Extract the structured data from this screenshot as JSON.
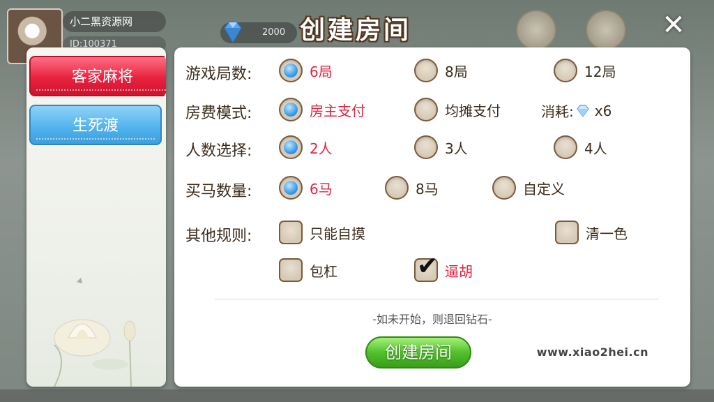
{
  "lobby": {
    "user_name": "小二黑资源网",
    "user_id": "ID:100371",
    "gem_count": "2000"
  },
  "dialog": {
    "title": "创建房间",
    "close_label": "✕"
  },
  "tabs": [
    {
      "label": "客家麻将",
      "active": true
    },
    {
      "label": "生死渡",
      "active": false
    }
  ],
  "rows": {
    "rounds": {
      "label": "游戏局数:",
      "options": [
        {
          "label": "6局",
          "selected": true
        },
        {
          "label": "8局",
          "selected": false
        },
        {
          "label": "12局",
          "selected": false
        }
      ]
    },
    "fee_mode": {
      "label": "房费模式:",
      "options": [
        {
          "label": "房主支付",
          "selected": true
        },
        {
          "label": "均摊支付",
          "selected": false
        }
      ],
      "cost_label": "消耗:",
      "cost_value": "x6"
    },
    "players": {
      "label": "人数选择:",
      "options": [
        {
          "label": "2人",
          "selected": true
        },
        {
          "label": "3人",
          "selected": false
        },
        {
          "label": "4人",
          "selected": false
        }
      ]
    },
    "horses": {
      "label": "买马数量:",
      "options": [
        {
          "label": "6马",
          "selected": true
        },
        {
          "label": "8马",
          "selected": false
        },
        {
          "label": "自定义",
          "selected": false
        }
      ]
    },
    "other_rules": {
      "label": "其他规则:",
      "options": [
        {
          "label": "只能自摸",
          "checked": false
        },
        {
          "label": "清一色",
          "checked": false
        },
        {
          "label": "包杠",
          "checked": false
        },
        {
          "label": "逼胡",
          "checked": true
        }
      ]
    }
  },
  "footer": {
    "refund_note": "-如未开始，则退回钻石-",
    "create_label": "创建房间",
    "watermark": "www.xiao2hei.cn"
  },
  "colors": {
    "selected_text": "#e8223f",
    "active_tab": "#e8223f",
    "inactive_tab": "#4fb2ec",
    "create_button": "#52c12c"
  }
}
